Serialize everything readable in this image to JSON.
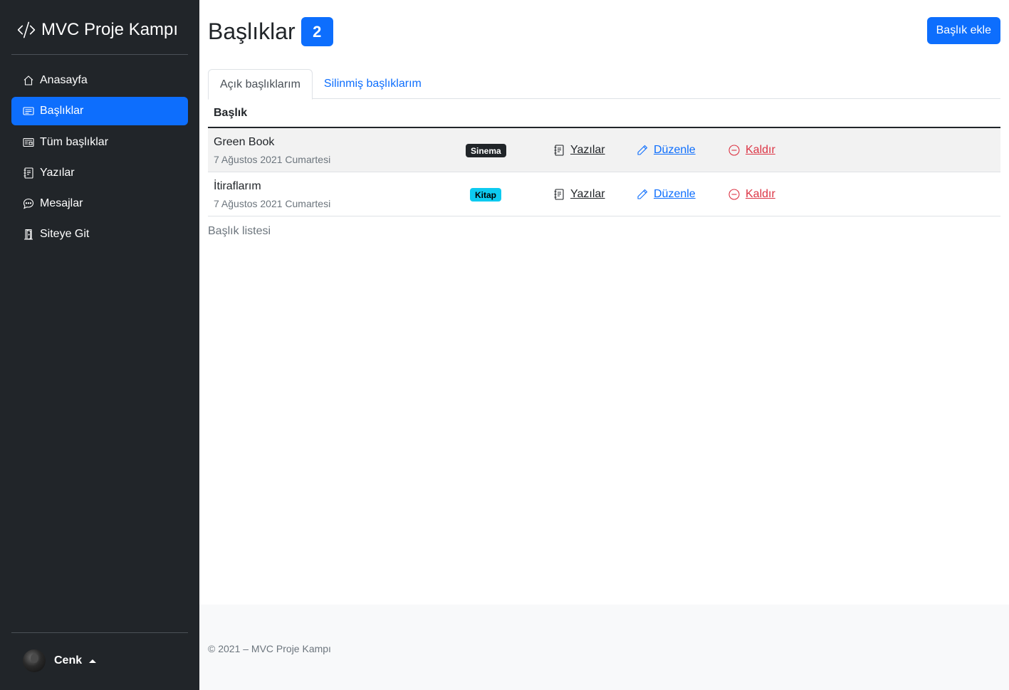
{
  "sidebar": {
    "brand": "MVC Proje Kampı",
    "items": [
      {
        "label": "Anasayfa",
        "icon": "house-icon"
      },
      {
        "label": "Başlıklar",
        "icon": "card-text-icon",
        "active": true
      },
      {
        "label": "Tüm başlıklar",
        "icon": "newspaper-icon"
      },
      {
        "label": "Yazılar",
        "icon": "journal-text-icon"
      },
      {
        "label": "Mesajlar",
        "icon": "chat-dots-icon"
      },
      {
        "label": "Siteye Git",
        "icon": "door-open-icon"
      }
    ],
    "user": {
      "name": "Cenk"
    }
  },
  "header": {
    "title": "Başlıklar",
    "count": "2",
    "add_button": "Başlık ekle"
  },
  "tabs": [
    {
      "label": "Açık başlıklarım",
      "active": true
    },
    {
      "label": "Silinmiş başlıklarım",
      "active": false
    }
  ],
  "table": {
    "header": "Başlık",
    "actions": {
      "posts": "Yazılar",
      "edit": "Düzenle",
      "remove": "Kaldır"
    },
    "rows": [
      {
        "title": "Green Book",
        "date": "7 Ağustos 2021 Cumartesi",
        "category": "Sinema"
      },
      {
        "title": "İtiraflarım",
        "date": "7 Ağustos 2021 Cumartesi",
        "category": "Kitap"
      }
    ],
    "caption": "Başlık listesi"
  },
  "footer": {
    "text": "© 2021 – MVC Proje Kampı"
  },
  "colors": {
    "primary": "#0d6efd",
    "sidebar": "#212529",
    "danger": "#dc3545",
    "info": "#0dcaf0"
  }
}
